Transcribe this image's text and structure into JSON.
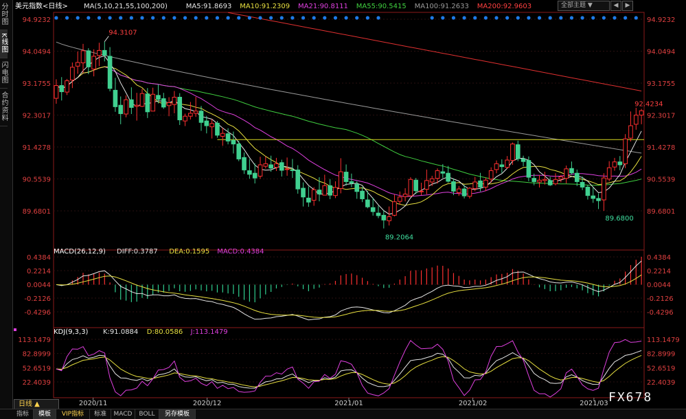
{
  "side_tabs": [
    "分时图",
    "K线图",
    "闪电图",
    "合约资料"
  ],
  "header": {
    "theme_label": "全部主题",
    "theme_arrow": "▼",
    "buttons": [
      "◀",
      "▶"
    ]
  },
  "bottom": {
    "period": "日线 ▲",
    "tabs": [
      "指标",
      "模板",
      "VIP指标",
      "标准",
      "MACD",
      "BOLL",
      "另存模板"
    ],
    "watermark": "FX678"
  },
  "chart_data": [
    {
      "type": "candlestick",
      "title": "美元指数",
      "period_label": "<日线>",
      "x": [
        "2020/11",
        "2020/12",
        "2021/01",
        "2021/02",
        "2021/03"
      ],
      "yticks": [
        94.9232,
        94.0494,
        93.1755,
        92.3017,
        91.4278,
        90.5539,
        89.6801
      ],
      "ylim": [
        89.2,
        94.9
      ],
      "ma_labels": [
        {
          "text": "MA(5,10,21,55,100,200)",
          "color": "#e6e6e6"
        },
        {
          "text": "MA5:91.8693",
          "color": "#e6e6e6"
        },
        {
          "text": "MA10:91.2309",
          "color": "#e8e040"
        },
        {
          "text": "MA21:90.8111",
          "color": "#e040e0"
        },
        {
          "text": "MA55:90.5415",
          "color": "#40d040"
        },
        {
          "text": "MA100:91.2633",
          "color": "#9a9a9a"
        },
        {
          "text": "MA200:92.9603",
          "color": "#ff4040"
        }
      ],
      "ohlc": [
        [
          92.76,
          93.28,
          92.61,
          93.11
        ],
        [
          93.11,
          93.34,
          92.7,
          92.94
        ],
        [
          92.93,
          93.29,
          92.85,
          93.24
        ],
        [
          93.26,
          93.74,
          93.04,
          93.61
        ],
        [
          93.64,
          94.04,
          93.43,
          93.74
        ],
        [
          93.73,
          94.25,
          93.45,
          94.06
        ],
        [
          94.06,
          94.13,
          93.42,
          93.62
        ],
        [
          93.56,
          94.1,
          93.36,
          93.91
        ],
        [
          93.93,
          94.28,
          93.64,
          94.07
        ],
        [
          94.07,
          94.31,
          93.77,
          93.94
        ],
        [
          93.91,
          94.16,
          92.95,
          93.03
        ],
        [
          92.98,
          93.32,
          92.39,
          92.53
        ],
        [
          92.57,
          92.81,
          92.05,
          92.34
        ],
        [
          92.33,
          92.84,
          92.24,
          92.72
        ],
        [
          92.72,
          93.06,
          92.33,
          92.51
        ],
        [
          92.54,
          92.91,
          92.15,
          92.57
        ],
        [
          92.54,
          93.02,
          92.52,
          92.89
        ],
        [
          92.88,
          93.04,
          92.22,
          92.39
        ],
        [
          92.41,
          93.05,
          92.41,
          92.87
        ],
        [
          92.84,
          93.14,
          92.62,
          92.73
        ],
        [
          92.75,
          92.91,
          92.47,
          92.52
        ],
        [
          92.56,
          92.79,
          92.27,
          92.64
        ],
        [
          92.59,
          92.96,
          92.35,
          92.79
        ],
        [
          92.79,
          92.9,
          92.03,
          92.17
        ],
        [
          92.14,
          92.34,
          92.0,
          92.27
        ],
        [
          92.27,
          92.66,
          92.18,
          92.35
        ],
        [
          92.35,
          92.8,
          92.25,
          92.41
        ],
        [
          92.41,
          92.55,
          91.87,
          92.1
        ],
        [
          92.14,
          92.28,
          91.8,
          92.01
        ],
        [
          91.98,
          92.19,
          91.66,
          92.07
        ],
        [
          92.08,
          92.14,
          91.68,
          91.75
        ],
        [
          91.72,
          91.95,
          91.46,
          91.8
        ],
        [
          91.79,
          91.94,
          91.5,
          91.59
        ],
        [
          91.61,
          91.85,
          91.25,
          91.51
        ],
        [
          91.51,
          91.6,
          91.04,
          91.1
        ],
        [
          91.14,
          91.28,
          90.69,
          90.8
        ],
        [
          90.78,
          91.1,
          90.56,
          90.68
        ],
        [
          90.71,
          90.98,
          90.43,
          90.58
        ],
        [
          90.63,
          91.16,
          90.56,
          90.94
        ],
        [
          90.9,
          91.17,
          90.84,
          90.97
        ],
        [
          90.94,
          91.19,
          90.75,
          90.85
        ],
        [
          90.87,
          91.13,
          90.77,
          90.97
        ],
        [
          91.0,
          91.08,
          90.62,
          90.79
        ],
        [
          90.81,
          91.14,
          90.64,
          90.83
        ],
        [
          90.8,
          91.1,
          90.58,
          90.79
        ],
        [
          90.8,
          90.93,
          90.15,
          90.28
        ],
        [
          90.3,
          90.46,
          89.8,
          90.06
        ],
        [
          90.03,
          90.35,
          89.79,
          89.92
        ],
        [
          89.97,
          90.33,
          89.82,
          90.26
        ],
        [
          90.25,
          90.6,
          89.94,
          90.14
        ],
        [
          90.11,
          90.67,
          90.11,
          90.37
        ],
        [
          90.37,
          90.55,
          90.0,
          90.11
        ],
        [
          90.1,
          90.49,
          90.03,
          90.32
        ],
        [
          90.29,
          91.12,
          90.16,
          90.75
        ],
        [
          90.74,
          90.95,
          90.37,
          90.48
        ],
        [
          90.48,
          90.7,
          90.33,
          90.44
        ],
        [
          90.41,
          90.49,
          90.01,
          90.21
        ],
        [
          90.22,
          90.34,
          89.92,
          90.01
        ],
        [
          89.98,
          90.23,
          89.75,
          89.79
        ],
        [
          89.77,
          90.04,
          89.55,
          89.66
        ],
        [
          89.62,
          89.82,
          89.48,
          89.55
        ],
        [
          89.56,
          89.69,
          89.2,
          89.43
        ],
        [
          89.41,
          89.8,
          89.28,
          89.52
        ],
        [
          89.56,
          90.13,
          89.53,
          89.93
        ],
        [
          89.94,
          90.21,
          89.85,
          90.06
        ],
        [
          90.07,
          90.3,
          89.94,
          90.14
        ],
        [
          90.09,
          90.6,
          90.07,
          90.54
        ],
        [
          90.52,
          90.58,
          90.14,
          90.23
        ],
        [
          90.2,
          90.45,
          90.11,
          90.22
        ],
        [
          90.27,
          90.81,
          90.13,
          90.51
        ],
        [
          90.47,
          90.64,
          90.36,
          90.56
        ],
        [
          90.57,
          90.84,
          90.43,
          90.78
        ],
        [
          90.75,
          90.96,
          90.58,
          90.71
        ],
        [
          90.71,
          90.91,
          90.45,
          90.49
        ],
        [
          90.48,
          90.57,
          90.11,
          90.22
        ],
        [
          90.18,
          90.36,
          90.09,
          90.28
        ],
        [
          90.28,
          90.39,
          90.02,
          90.09
        ],
        [
          90.08,
          90.33,
          90.02,
          90.3
        ],
        [
          90.29,
          90.61,
          90.22,
          90.47
        ],
        [
          90.5,
          90.72,
          90.21,
          90.33
        ],
        [
          90.33,
          90.59,
          90.22,
          90.52
        ],
        [
          90.55,
          90.87,
          90.45,
          90.78
        ],
        [
          90.81,
          91.06,
          90.71,
          90.97
        ],
        [
          90.94,
          91.09,
          90.72,
          90.89
        ],
        [
          90.87,
          91.18,
          90.83,
          91.07
        ],
        [
          91.06,
          91.55,
          90.94,
          91.51
        ],
        [
          91.49,
          91.6,
          91.04,
          91.11
        ],
        [
          91.1,
          91.19,
          90.9,
          91.03
        ],
        [
          91.06,
          91.17,
          90.49,
          90.6
        ],
        [
          90.57,
          90.7,
          90.38,
          90.48
        ],
        [
          90.47,
          90.66,
          90.32,
          90.52
        ],
        [
          90.51,
          90.75,
          90.4,
          90.54
        ],
        [
          90.51,
          90.61,
          90.36,
          90.39
        ],
        [
          90.42,
          90.71,
          90.38,
          90.54
        ],
        [
          90.55,
          90.66,
          90.46,
          90.61
        ],
        [
          90.57,
          90.92,
          90.43,
          90.83
        ],
        [
          90.84,
          91.03,
          90.67,
          90.72
        ],
        [
          90.71,
          90.81,
          90.36,
          90.48
        ],
        [
          90.46,
          90.62,
          90.25,
          90.33
        ],
        [
          90.33,
          90.39,
          89.99,
          90.1
        ],
        [
          90.09,
          90.33,
          89.9,
          90.02
        ],
        [
          90.02,
          90.16,
          89.73,
          89.96
        ],
        [
          89.98,
          90.71,
          89.68,
          90.58
        ],
        [
          90.55,
          91.04,
          90.49,
          90.86
        ],
        [
          90.88,
          91.13,
          90.78,
          91.02
        ],
        [
          91.02,
          91.18,
          90.79,
          90.94
        ],
        [
          90.97,
          91.78,
          90.85,
          91.65
        ],
        [
          91.67,
          92.4,
          91.58,
          92.01
        ],
        [
          92.05,
          92.5,
          91.9,
          92.3
        ],
        [
          92.3,
          92.47,
          92.05,
          92.42
        ]
      ],
      "annotations": [
        {
          "label": "94.3107",
          "type": "high"
        },
        {
          "label": "89.2064",
          "type": "low"
        },
        {
          "label": "89.6800",
          "type": "low"
        },
        {
          "label": "92.4234",
          "type": "last"
        }
      ]
    },
    {
      "type": "macd",
      "label": "MACD(26,12,9)",
      "stats": [
        {
          "text": "DIFF:0.3787",
          "color": "#e6e6e6"
        },
        {
          "text": "DEA:0.1595",
          "color": "#e8e040"
        },
        {
          "text": "MACD:0.4384",
          "color": "#e040e0"
        }
      ],
      "yticks": [
        0.4384,
        0.2214,
        0.0044,
        -0.2126,
        -0.4296
      ]
    },
    {
      "type": "kdj",
      "label": "KDJ(9,3,3)",
      "stats": [
        {
          "text": "K:91.0884",
          "color": "#e6e6e6"
        },
        {
          "text": "D:80.0586",
          "color": "#e8e040"
        },
        {
          "text": "J:113.1479",
          "color": "#e040e0"
        }
      ],
      "yticks": [
        113.1479,
        82.8999,
        52.6519,
        22.4039
      ]
    }
  ]
}
